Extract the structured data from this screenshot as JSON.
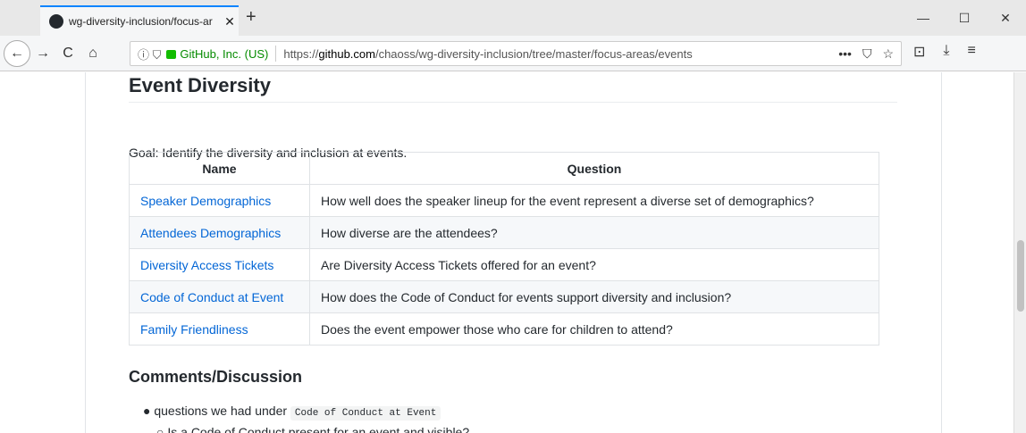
{
  "tab": {
    "title": "wg-diversity-inclusion/focus-ar",
    "close": "✕",
    "new": "+"
  },
  "window": {
    "minimize": "—",
    "maximize": "☐",
    "close": "✕"
  },
  "nav": {
    "back": "←",
    "forward": "→",
    "reload": "C",
    "home": "⌂"
  },
  "urlbar": {
    "site_identity": "GitHub, Inc. (US)",
    "url_prefix": "https://",
    "url_host": "github.com",
    "url_path": "/chaoss/wg-diversity-inclusion/tree/master/focus-areas/events",
    "more": "•••"
  },
  "page": {
    "heading": "Event Diversity",
    "goal": "Goal: Identify the diversity and inclusion at events.",
    "table": {
      "headers": [
        "Name",
        "Question"
      ],
      "rows": [
        {
          "name": "Speaker Demographics",
          "question": "How well does the speaker lineup for the event represent a diverse set of demographics?"
        },
        {
          "name": "Attendees Demographics",
          "question": "How diverse are the attendees?"
        },
        {
          "name": "Diversity Access Tickets",
          "question": "Are Diversity Access Tickets offered for an event?"
        },
        {
          "name": "Code of Conduct at Event",
          "question": "How does the Code of Conduct for events support diversity and inclusion?"
        },
        {
          "name": "Family Friendliness",
          "question": "Does the event empower those who care for children to attend?"
        }
      ]
    },
    "comments_heading": "Comments/Discussion",
    "bullet_text": "questions we had under",
    "bullet_code": "Code of Conduct at Event",
    "sub_bullet": "Is a Code of Conduct present for an event and visible?"
  }
}
